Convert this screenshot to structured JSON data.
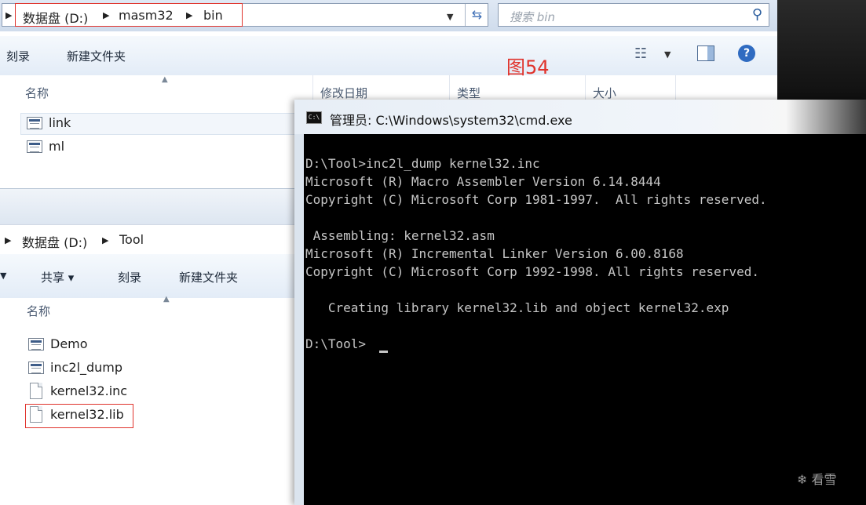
{
  "figure_label": "图54",
  "explorer_bin": {
    "breadcrumb": [
      "数据盘 (D:)",
      "masm32",
      "bin"
    ],
    "search_placeholder": "搜索 bin",
    "toolbar": {
      "burn": "刻录",
      "new_folder": "新建文件夹"
    },
    "columns": {
      "name": "名称",
      "modified": "修改日期",
      "type": "类型",
      "size": "大小"
    },
    "files": [
      "link",
      "ml"
    ]
  },
  "explorer_tool": {
    "breadcrumb": [
      "数据盘 (D:)",
      "Tool"
    ],
    "toolbar": {
      "share": "共享 ▾",
      "burn": "刻录",
      "new_folder": "新建文件夹"
    },
    "columns": {
      "name": "名称"
    },
    "files": [
      "Demo",
      "inc2l_dump",
      "kernel32.inc",
      "kernel32.lib"
    ]
  },
  "cmd": {
    "title": "管理员: C:\\Windows\\system32\\cmd.exe",
    "icon_text": "C:\\",
    "lines": [
      "",
      "D:\\Tool>inc2l_dump kernel32.inc",
      "Microsoft (R) Macro Assembler Version 6.14.8444",
      "Copyright (C) Microsoft Corp 1981-1997.  All rights reserved.",
      "",
      " Assembling: kernel32.asm",
      "Microsoft (R) Incremental Linker Version 6.00.8168",
      "Copyright (C) Microsoft Corp 1992-1998. All rights reserved.",
      "",
      "   Creating library kernel32.lib and object kernel32.exp",
      "",
      "D:\\Tool>"
    ]
  },
  "watermark": "看雪"
}
